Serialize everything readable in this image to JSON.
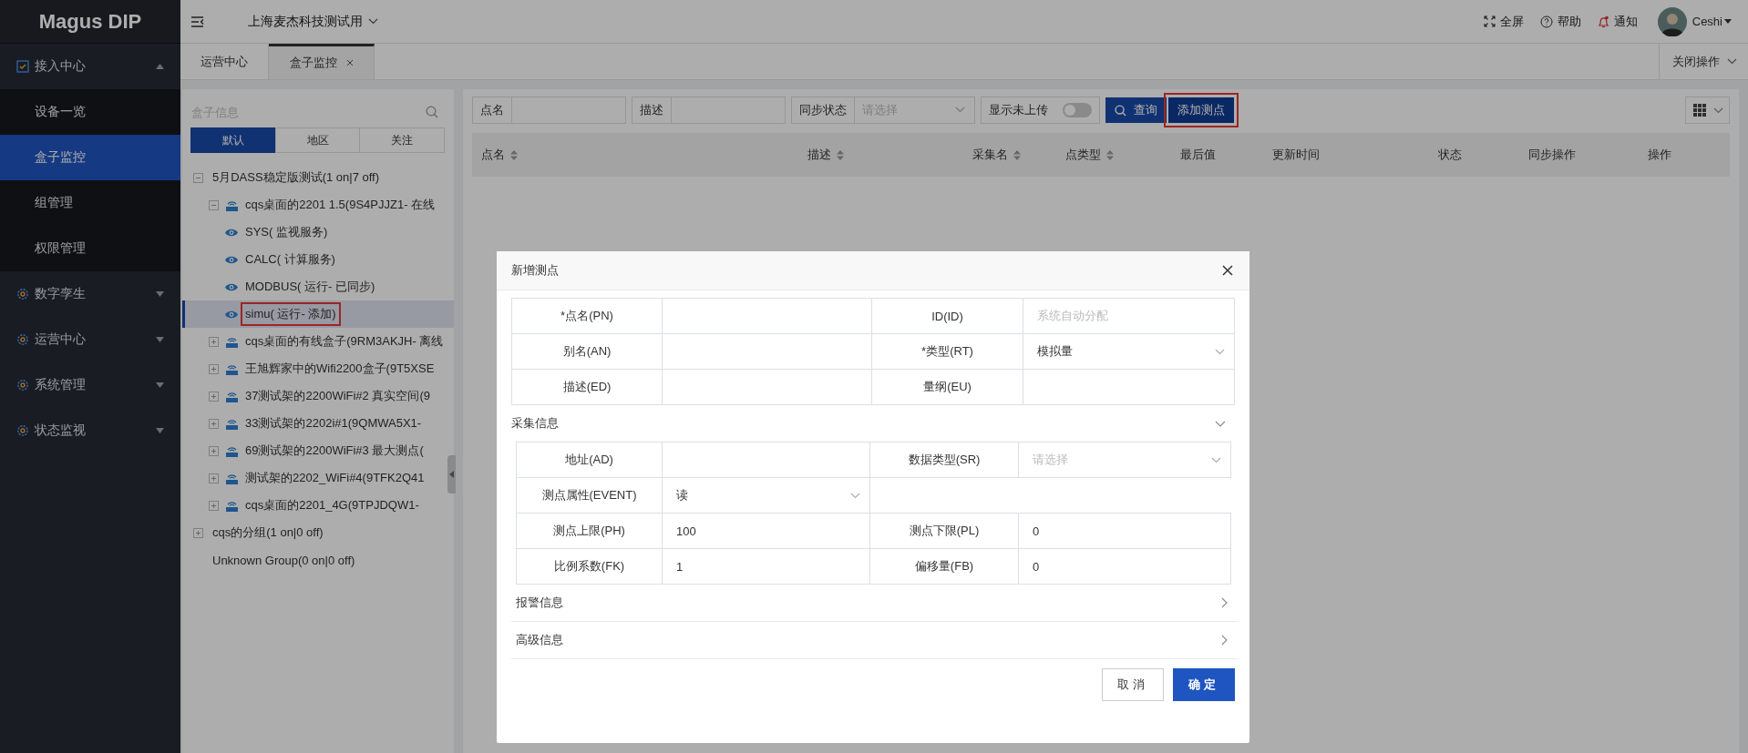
{
  "app": {
    "logo": "Magus DIP"
  },
  "sidebar": {
    "items": [
      {
        "label": "接入中心",
        "expanded": true,
        "children": [
          {
            "label": "设备一览",
            "selected": false
          },
          {
            "label": "盒子监控",
            "selected": true
          },
          {
            "label": "组管理",
            "selected": false
          },
          {
            "label": "权限管理",
            "selected": false
          }
        ]
      },
      {
        "label": "数字孪生",
        "expanded": false
      },
      {
        "label": "运营中心",
        "expanded": false
      },
      {
        "label": "系统管理",
        "expanded": false
      },
      {
        "label": "状态监视",
        "expanded": false
      }
    ]
  },
  "topbar": {
    "org": "上海麦杰科技测试用",
    "actions": [
      {
        "kind": "fullscreen",
        "label": "全屏"
      },
      {
        "kind": "help",
        "label": "帮助"
      },
      {
        "kind": "notify",
        "label": "通知"
      }
    ],
    "user": "Ceshi"
  },
  "tabs": [
    {
      "label": "运营中心",
      "selected": false,
      "closable": false
    },
    {
      "label": "盒子监控",
      "selected": true,
      "closable": true
    }
  ],
  "close_menu": "关闭操作",
  "tree": {
    "search_placeholder": "盒子信息",
    "tabs": [
      {
        "label": "默认",
        "selected": true
      },
      {
        "label": "地区",
        "selected": false
      },
      {
        "label": "关注",
        "selected": false
      }
    ],
    "nodes": [
      {
        "kind": "group",
        "label": "5月DASS稳定版测试(1 on|7 off)",
        "expanded": true,
        "children": [
          {
            "kind": "box",
            "label": "cqs桌面的2201 1.5(9S4PJJZ1- 在线",
            "expanded": true,
            "children": [
              {
                "kind": "service",
                "label": "SYS( 监视服务)",
                "selected": false,
                "annotated": false
              },
              {
                "kind": "service",
                "label": "CALC( 计算服务)",
                "selected": false,
                "annotated": false
              },
              {
                "kind": "service",
                "label": "MODBUS( 运行- 已同步)",
                "selected": false,
                "annotated": false
              },
              {
                "kind": "service",
                "label": "simu( 运行- 添加)",
                "selected": true,
                "annotated": true
              }
            ]
          },
          {
            "kind": "box",
            "label": "cqs桌面的有线盒子(9RM3AKJH- 离线",
            "expanded": false
          },
          {
            "kind": "box",
            "label": "王旭辉家中的Wifi2200盒子(9T5XSE",
            "expanded": false
          },
          {
            "kind": "box",
            "label": "37测试架的2200WiFi#2 真实空间(9",
            "expanded": false
          },
          {
            "kind": "box",
            "label": "33测试架的2202i#1(9QMWA5X1-",
            "expanded": false
          },
          {
            "kind": "box",
            "label": "69测试架的2200WiFi#3 最大测点(",
            "expanded": false
          },
          {
            "kind": "box",
            "label": "测试架的2202_WiFi#4(9TFK2Q41",
            "expanded": false
          },
          {
            "kind": "box",
            "label": "cqs桌面的2201_4G(9TPJDQW1-",
            "expanded": false
          }
        ]
      },
      {
        "kind": "group",
        "label": "cqs的分组(1 on|0 off)",
        "expanded": false
      },
      {
        "kind": "empty_group",
        "label": "Unknown Group(0 on|0 off)"
      }
    ]
  },
  "filters": [
    {
      "kind": "input",
      "label": "点名"
    },
    {
      "kind": "input",
      "label": "描述"
    },
    {
      "kind": "select",
      "label": "同步状态",
      "placeholder": "请选择"
    },
    {
      "kind": "toggle",
      "label": "显示未上传",
      "on": false
    }
  ],
  "buttons": [
    {
      "kind": "search",
      "label": "查询",
      "annotated": false
    },
    {
      "kind": "plain",
      "label": "添加测点",
      "annotated": true
    }
  ],
  "table": {
    "columns": [
      {
        "label": "点名",
        "sortable": true
      },
      {
        "label": "描述",
        "sortable": true
      },
      {
        "label": "采集名",
        "sortable": true
      },
      {
        "label": "点类型",
        "sortable": true
      },
      {
        "label": "最后值",
        "sortable": false
      },
      {
        "label": "更新时间",
        "sortable": false
      },
      {
        "label": "状态",
        "sortable": false
      },
      {
        "label": "同步操作",
        "sortable": false
      },
      {
        "label": "操作",
        "sortable": false
      }
    ]
  },
  "modal": {
    "title": "新增测点",
    "rows": [
      [
        {
          "label": "*点名(PN)",
          "kind": "input"
        },
        {
          "label": "ID(ID)",
          "kind": "input",
          "placeholder": "系统自动分配"
        }
      ],
      [
        {
          "label": "别名(AN)",
          "kind": "input"
        },
        {
          "label": "*类型(RT)",
          "kind": "select",
          "value": "模拟量"
        }
      ],
      [
        {
          "label": "描述(ED)",
          "kind": "input"
        },
        {
          "label": "量纲(EU)",
          "kind": "input"
        }
      ]
    ],
    "sections": [
      {
        "title": "采集信息",
        "expanded": true,
        "rows": [
          [
            {
              "label": "地址(AD)",
              "kind": "input"
            },
            {
              "label": "数据类型(SR)",
              "kind": "select",
              "placeholder": "请选择"
            }
          ],
          [
            {
              "label": "测点属性(EVENT)",
              "kind": "select",
              "value": "读"
            }
          ],
          [
            {
              "label": "测点上限(PH)",
              "kind": "input",
              "value": "100"
            },
            {
              "label": "测点下限(PL)",
              "kind": "input",
              "value": "0"
            }
          ],
          [
            {
              "label": "比例系数(FK)",
              "kind": "input",
              "value": "1"
            },
            {
              "label": "偏移量(FB)",
              "kind": "input",
              "value": "0"
            }
          ]
        ]
      },
      {
        "title": "报警信息",
        "expanded": false
      },
      {
        "title": "高级信息",
        "expanded": false
      }
    ],
    "buttons": [
      {
        "kind": "plain",
        "label": "取消"
      },
      {
        "kind": "primary",
        "label": "确定"
      }
    ]
  }
}
